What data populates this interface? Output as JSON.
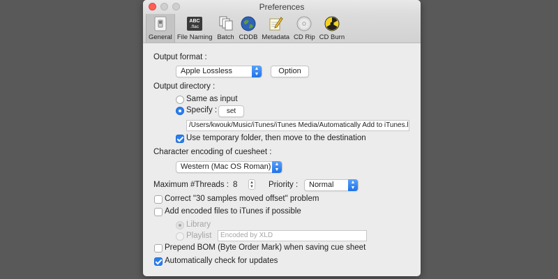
{
  "window": {
    "title": "Preferences"
  },
  "toolbar": {
    "items": [
      {
        "label": "General",
        "icon": "switch-icon"
      },
      {
        "label": "File Naming",
        "icon": "abc-flac-icon",
        "icon_text_top": "ABC",
        "icon_text_bottom": ".flac"
      },
      {
        "label": "Batch",
        "icon": "documents-icon"
      },
      {
        "label": "CDDB",
        "icon": "globe-icon"
      },
      {
        "label": "Metadata",
        "icon": "pencil-paper-icon"
      },
      {
        "label": "CD Rip",
        "icon": "cd-icon"
      },
      {
        "label": "CD Burn",
        "icon": "radiation-icon"
      }
    ]
  },
  "general": {
    "output_format_label": "Output format :",
    "output_format_value": "Apple Lossless",
    "option_button": "Option",
    "output_directory_label": "Output directory :",
    "same_as_input": "Same as input",
    "specify": "Specify :",
    "set_button": "set",
    "directory_path": "/Users/kwouk/Music/iTunes/iTunes Media/Automatically Add to iTunes.locali",
    "use_temp_folder": "Use temporary folder, then move to the destination",
    "char_encoding_label": "Character encoding of cuesheet :",
    "char_encoding_value": "Western (Mac OS Roman)",
    "threads_label": "Maximum #Threads :",
    "threads_value": "8",
    "priority_label": "Priority :",
    "priority_value": "Normal",
    "correct_offset": "Correct \"30 samples moved offset\" problem",
    "add_to_itunes": "Add encoded files to iTunes if possible",
    "library": "Library",
    "playlist": "Playlist",
    "playlist_placeholder": "Encoded by XLD",
    "prepend_bom": "Prepend BOM (Byte Order Mark) when saving cue sheet",
    "auto_update": "Automatically check for updates"
  },
  "state": {
    "same_as_input": false,
    "specify": true,
    "use_temp_folder": true,
    "correct_offset": false,
    "add_to_itunes": false,
    "library": true,
    "playlist": false,
    "prepend_bom": false,
    "auto_update": true
  },
  "colors": {
    "accent": "#2a7ff0",
    "window_bg": "#ececec",
    "desktop_bg": "#595959",
    "close_red": "#ff5f57"
  }
}
